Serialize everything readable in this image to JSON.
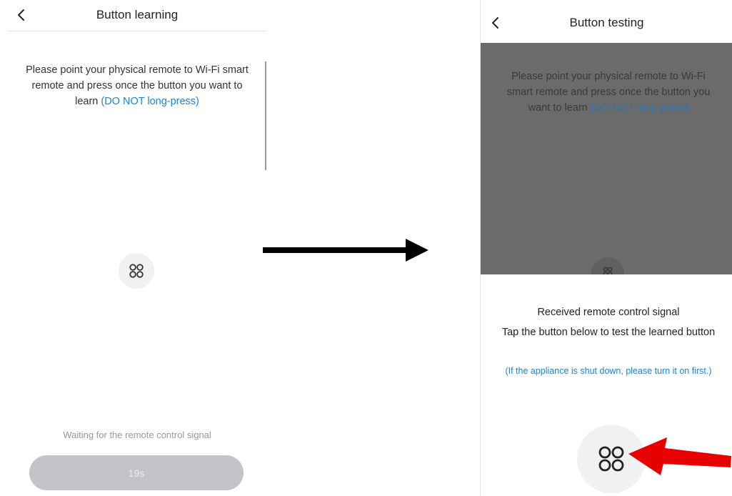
{
  "left_screen": {
    "title": "Button learning",
    "instruction_main": "Please point your physical remote to Wi-Fi smart remote and press once the button you want to learn",
    "instruction_highlight": "(DO NOT long-press)",
    "center_icon": "clover-command-icon",
    "waiting_text": "Waiting for the remote control signal",
    "countdown_label": "19s"
  },
  "right_screen": {
    "title": "Button testing",
    "instruction_main": "Please point your physical remote to Wi-Fi smart remote and press once the button you want to learn",
    "instruction_highlight": "(DO NOT long-press)",
    "received_line1": "Received remote control signal",
    "received_line2": "Tap the button below to test the learned button",
    "note": "(If the appliance is shut down, please turn it on first.)",
    "test_icon": "clover-command-icon"
  },
  "colors": {
    "accent_blue": "#1a84d6",
    "overlay_gray": "#6b6b6b",
    "disabled_button": "#c4c4c8",
    "annotation_red": "#e60000"
  },
  "icons": {
    "back": "chevron-left-icon",
    "transition": "right-arrow-icon",
    "pointer": "red-arrow-icon"
  }
}
